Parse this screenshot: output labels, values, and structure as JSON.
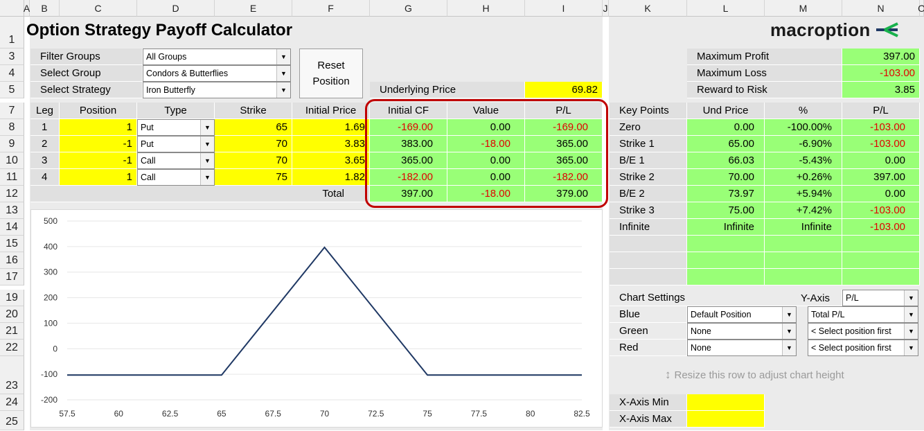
{
  "columns": [
    "A",
    "B",
    "C",
    "D",
    "E",
    "F",
    "G",
    "H",
    "I",
    "J",
    "K",
    "L",
    "M",
    "N",
    "O"
  ],
  "rows": [
    "1",
    "3",
    "4",
    "5",
    "7",
    "8",
    "9",
    "10",
    "11",
    "12",
    "13",
    "14",
    "15",
    "16",
    "17",
    "19",
    "20",
    "21",
    "22",
    "23",
    "24",
    "25"
  ],
  "title": "Option Strategy Payoff Calculator",
  "logo": "macroption",
  "filters": {
    "filter_groups_label": "Filter Groups",
    "filter_groups_value": "All Groups",
    "select_group_label": "Select Group",
    "select_group_value": "Condors & Butterflies",
    "select_strategy_label": "Select Strategy",
    "select_strategy_value": "Iron Butterfly"
  },
  "reset_button": {
    "line1": "Reset",
    "line2": "Position"
  },
  "underlying": {
    "label": "Underlying Price",
    "value": "69.82"
  },
  "summary": {
    "max_profit_label": "Maximum Profit",
    "max_profit": "397.00",
    "max_loss_label": "Maximum Loss",
    "max_loss": "-103.00",
    "rr_label": "Reward to Risk",
    "rr": "3.85"
  },
  "legs_headers": [
    "Leg",
    "Position",
    "Type",
    "Strike",
    "Initial Price",
    "Initial CF",
    "Value",
    "P/L"
  ],
  "legs": [
    {
      "leg": "1",
      "position": "1",
      "type": "Put",
      "strike": "65",
      "price": "1.69",
      "cf": "-169.00",
      "value": "0.00",
      "pl": "-169.00"
    },
    {
      "leg": "2",
      "position": "-1",
      "type": "Put",
      "strike": "70",
      "price": "3.83",
      "cf": "383.00",
      "value": "-18.00",
      "pl": "365.00"
    },
    {
      "leg": "3",
      "position": "-1",
      "type": "Call",
      "strike": "70",
      "price": "3.65",
      "cf": "365.00",
      "value": "0.00",
      "pl": "365.00"
    },
    {
      "leg": "4",
      "position": "1",
      "type": "Call",
      "strike": "75",
      "price": "1.82",
      "cf": "-182.00",
      "value": "0.00",
      "pl": "-182.00"
    }
  ],
  "totals": {
    "label": "Total",
    "cf": "397.00",
    "value": "-18.00",
    "pl": "379.00"
  },
  "keypoints_headers": [
    "Key Points",
    "Und Price",
    "%",
    "P/L"
  ],
  "keypoints": [
    {
      "name": "Zero",
      "und": "0.00",
      "pct": "-100.00%",
      "pl": "-103.00"
    },
    {
      "name": "Strike 1",
      "und": "65.00",
      "pct": "-6.90%",
      "pl": "-103.00"
    },
    {
      "name": "B/E 1",
      "und": "66.03",
      "pct": "-5.43%",
      "pl": "0.00"
    },
    {
      "name": "Strike 2",
      "und": "70.00",
      "pct": "+0.26%",
      "pl": "397.00"
    },
    {
      "name": "B/E 2",
      "und": "73.97",
      "pct": "+5.94%",
      "pl": "0.00"
    },
    {
      "name": "Strike 3",
      "und": "75.00",
      "pct": "+7.42%",
      "pl": "-103.00"
    },
    {
      "name": "Infinite",
      "und": "Infinite",
      "pct": "Infinite",
      "pl": "-103.00"
    }
  ],
  "chart_settings": {
    "label": "Chart Settings",
    "yaxis_label": "Y-Axis",
    "yaxis_value": "P/L",
    "rows": [
      {
        "label": "Blue",
        "position": "Default Position",
        "series": "Total P/L"
      },
      {
        "label": "Green",
        "position": "None",
        "series": "< Select position first"
      },
      {
        "label": "Red",
        "position": "None",
        "series": "< Select position first"
      }
    ]
  },
  "resize_hint": "Resize this row to adjust chart height",
  "xaxis": {
    "min_label": "X-Axis Min",
    "max_label": "X-Axis Max"
  },
  "colors": {
    "green": "#99ff77",
    "yellow": "#ffff00",
    "negative": "#e00000",
    "line": "#1f3864",
    "highlight": "#c00000"
  },
  "chart_data": {
    "type": "line",
    "x_ticks": [
      "57.5",
      "60",
      "62.5",
      "65",
      "67.5",
      "70",
      "72.5",
      "75",
      "77.5",
      "80",
      "82.5"
    ],
    "y_ticks": [
      "500",
      "400",
      "300",
      "200",
      "100",
      "0",
      "-100",
      "-200"
    ],
    "xlim": [
      57.5,
      82.5
    ],
    "ylim": [
      -200,
      500
    ],
    "series": [
      {
        "x": [
          57.5,
          65,
          70,
          75,
          82.5
        ],
        "y": [
          -103,
          -103,
          397,
          -103,
          -103
        ]
      }
    ]
  }
}
